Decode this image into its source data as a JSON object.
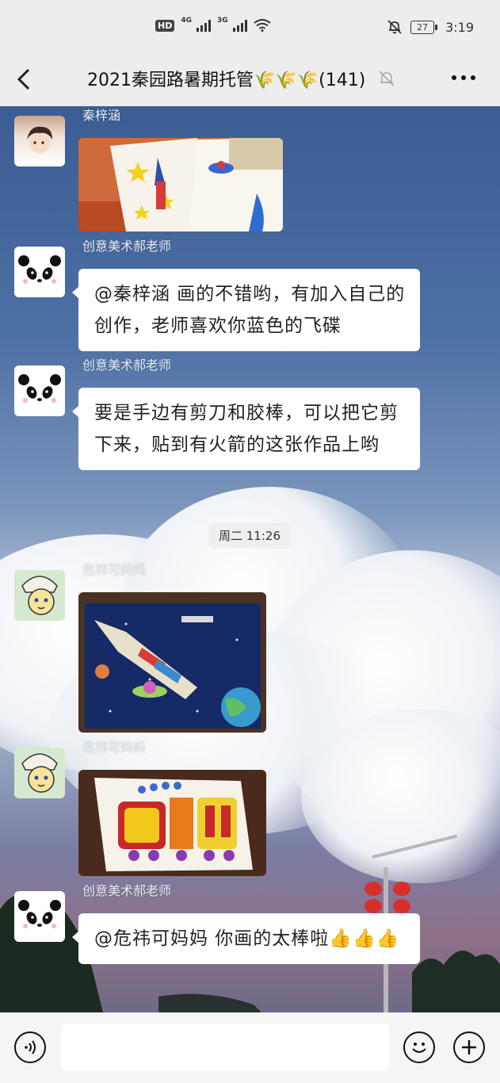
{
  "status_bar": {
    "hd_label": "HD",
    "net1": "4G",
    "net2": "3G",
    "battery": "27",
    "time": "3:19"
  },
  "header": {
    "title": "2021秦园路暑期托管🌾🌾🌾(141)",
    "back_icon": "chevron-left-icon",
    "mute_icon": "bell-off-icon",
    "more_icon": "more-icon"
  },
  "messages": [
    {
      "sender": "秦梓涵",
      "type": "image",
      "image": "child-drawings-rocket"
    },
    {
      "sender": "创意美术郝老师",
      "type": "text",
      "text": "@秦梓涵 画的不错哟，有加入自己的创作，老师喜欢你蓝色的飞碟"
    },
    {
      "sender": "创意美术郝老师",
      "type": "text",
      "text": "要是手边有剪刀和胶棒，可以把它剪下来，贴到有火箭的这张作品上哟"
    },
    {
      "sender": "危祎可妈妈",
      "type": "image",
      "image": "space-rocket-drawing"
    },
    {
      "sender": "危祎可妈妈",
      "type": "image",
      "image": "colorful-train-drawing"
    },
    {
      "sender": "创意美术郝老师",
      "type": "text",
      "text": "@危祎可妈妈 你画的太棒啦👍👍👍"
    }
  ],
  "timestamp": "周二 11:26",
  "input_bar": {
    "voice_icon": "voice-icon",
    "emoji_icon": "emoji-icon",
    "plus_icon": "plus-icon"
  }
}
